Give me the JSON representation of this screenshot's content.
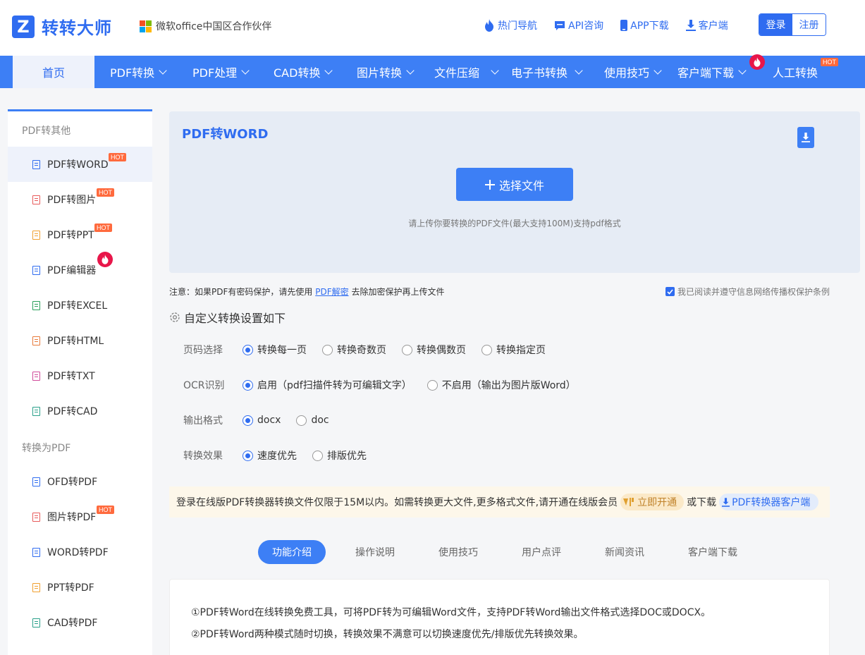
{
  "header": {
    "brand": "转转大师",
    "logo_letter": "Z",
    "partner": "微软office中国区合作伙伴",
    "links": [
      "热门导航",
      "API咨询",
      "APP下载",
      "客户端"
    ],
    "login": "登录",
    "register": "注册"
  },
  "nav": {
    "home": "首页",
    "items": [
      "PDF转换",
      "PDF处理",
      "CAD转换",
      "图片转换",
      "文件压缩",
      "电子书转换",
      "使用技巧",
      "客户端下载",
      "人工转换"
    ],
    "hot": "HOT"
  },
  "sidebar": {
    "group1": "PDF转其他",
    "group1_items": [
      {
        "label": "PDF转WORD",
        "badge": "HOT"
      },
      {
        "label": "PDF转图片",
        "badge": "HOT"
      },
      {
        "label": "PDF转PPT",
        "badge": "HOT"
      },
      {
        "label": "PDF编辑器",
        "badge": ""
      },
      {
        "label": "PDF转EXCEL",
        "badge": ""
      },
      {
        "label": "PDF转HTML",
        "badge": ""
      },
      {
        "label": "PDF转TXT",
        "badge": ""
      },
      {
        "label": "PDF转CAD",
        "badge": ""
      }
    ],
    "group2": "转换为PDF",
    "group2_items": [
      {
        "label": "OFD转PDF",
        "badge": ""
      },
      {
        "label": "图片转PDF",
        "badge": "HOT"
      },
      {
        "label": "WORD转PDF",
        "badge": ""
      },
      {
        "label": "PPT转PDF",
        "badge": ""
      },
      {
        "label": "CAD转PDF",
        "badge": ""
      }
    ]
  },
  "upload": {
    "title": "PDF转WORD",
    "button": "选择文件",
    "hint": "请上传你要转换的PDF文件(最大支持100M)支持pdf格式"
  },
  "note": {
    "prefix": "注意：如果PDF有密码保护，请先使用",
    "link": "PDF解密",
    "suffix": "去除加密保护再上传文件"
  },
  "agree": "我已阅读并遵守信息网络传播权保护条例",
  "settings": {
    "title": "自定义转换设置如下",
    "rows": [
      {
        "label": "页码选择",
        "options": [
          "转换每一页",
          "转换奇数页",
          "转换偶数页",
          "转换指定页"
        ],
        "selected": 0
      },
      {
        "label": "OCR识别",
        "options": [
          "启用（pdf扫描件转为可编辑文字）",
          "不启用（输出为图片版Word）"
        ],
        "selected": 0
      },
      {
        "label": "输出格式",
        "options": [
          "docx",
          "doc"
        ],
        "selected": 0
      },
      {
        "label": "转换效果",
        "options": [
          "速度优先",
          "排版优先"
        ],
        "selected": 0
      }
    ]
  },
  "limit": {
    "text": "登录在线版PDF转换器转换文件仅限于15M以内。如需转换更大文件,更多格式文件,请开通在线版会员",
    "vip": "立即开通",
    "or": "或下载",
    "client": "PDF转换器客户端"
  },
  "tabs": [
    "功能介绍",
    "操作说明",
    "使用技巧",
    "用户点评",
    "新闻资讯",
    "客户端下载"
  ],
  "content": [
    "①PDF转Word在线转换免费工具，可将PDF转为可编辑Word文件，支持PDF转Word输出文件格式选择DOC或DOCX。",
    "②PDF转Word两种模式随时切换，转换效果不满意可以切换速度优先/排版优先转换效果。"
  ],
  "colors": {
    "primary": "#3d7ff5",
    "hot": "#ff6a3d",
    "fire": "#e8164a"
  }
}
